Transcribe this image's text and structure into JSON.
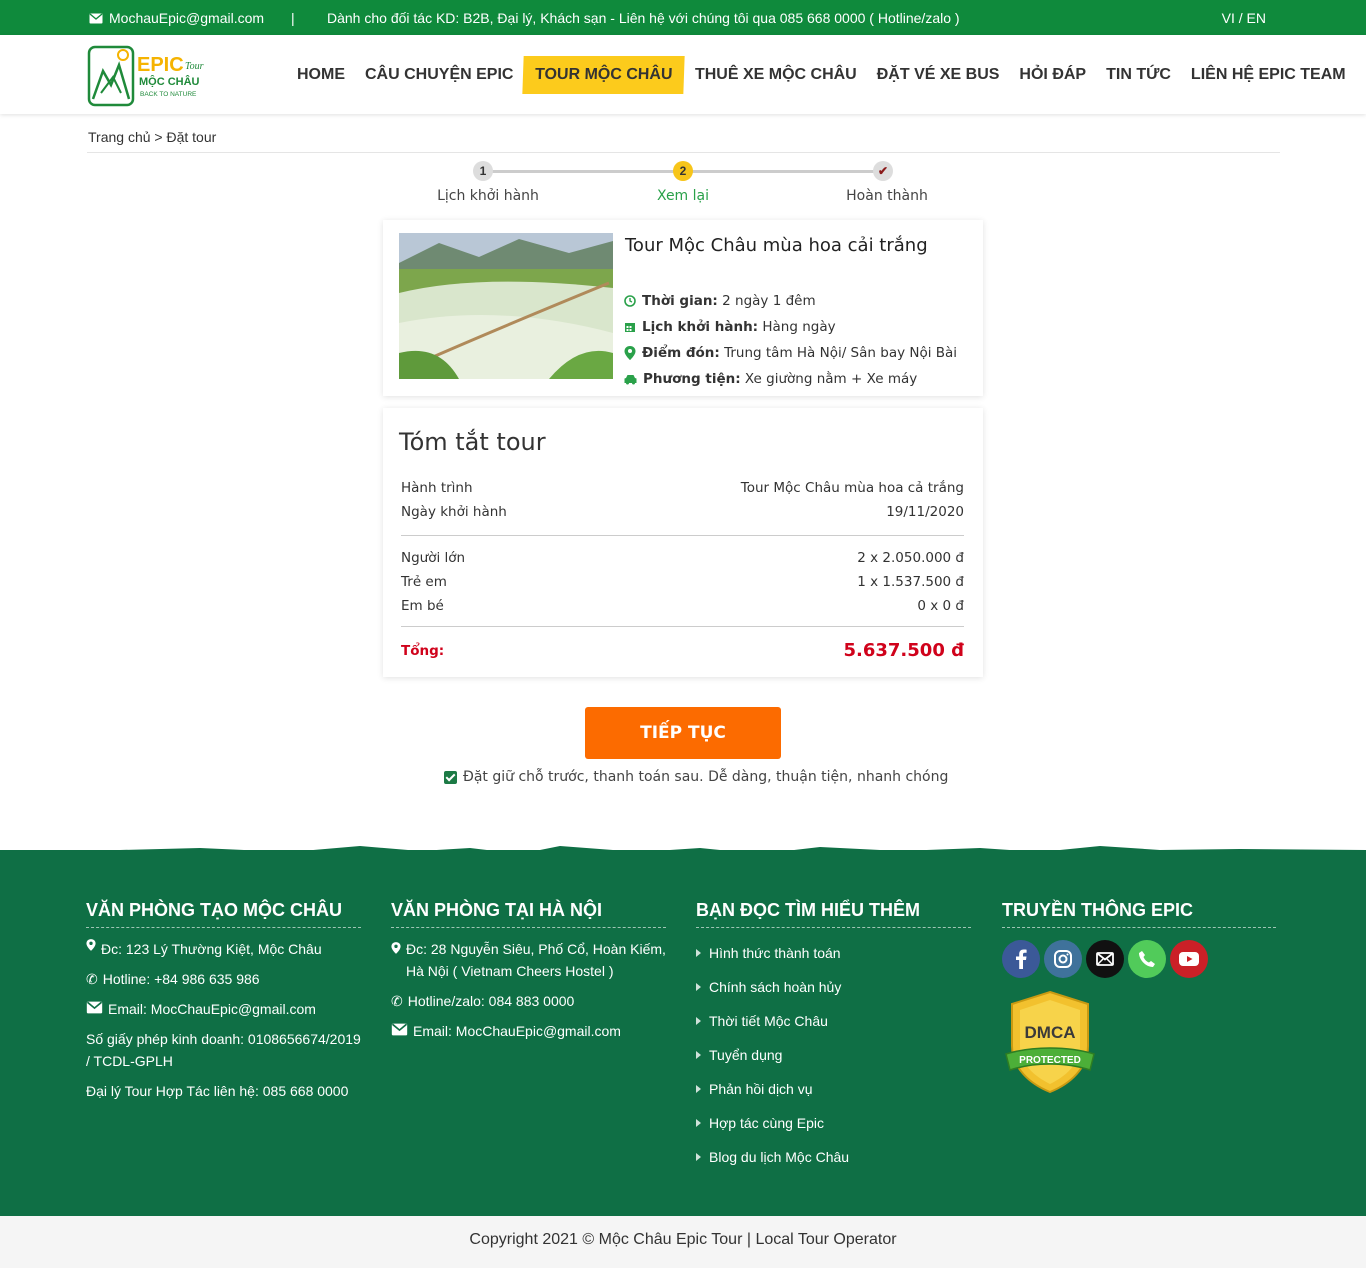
{
  "topbar": {
    "email": "MochauEpic@gmail.com",
    "separator": "|",
    "notice": "Dành cho đối tác KD: B2B, Đại lý, Khách sạn - Liên hệ với chúng tôi qua 085 668 0000 ( Hotline/zalo )",
    "lang": "VI / EN"
  },
  "logo": {
    "brand": "EPIC",
    "sub": "Tour",
    "name": "MỘC CHÂU",
    "tagline": "BACK TO NATURE"
  },
  "nav": [
    "HOME",
    "CÂU CHUYỆN EPIC",
    "TOUR MỘC CHÂU",
    "THUÊ XE MỘC CHÂU",
    "ĐẶT VÉ XE BUS",
    "HỎI ĐÁP",
    "TIN TỨC",
    "LIÊN HỆ EPIC TEAM"
  ],
  "breadcrumb": "Trang chủ > Đặt tour",
  "steps": [
    {
      "num": "1",
      "label": "Lịch khởi hành"
    },
    {
      "num": "2",
      "label": "Xem lại"
    },
    {
      "num": "✔",
      "label": "Hoàn thành"
    }
  ],
  "tour": {
    "title": "Tour Mộc Châu mùa hoa cải trắng",
    "info": [
      {
        "icon": "clock-icon",
        "label": "Thời gian:",
        "value": " 2 ngày 1 đêm"
      },
      {
        "icon": "calendar-icon",
        "label": "Lịch khởi hành:",
        "value": " Hàng ngày"
      },
      {
        "icon": "map-pin-icon",
        "label": "Điểm đón:",
        "value": " Trung tâm Hà Nội/ Sân bay Nội Bài"
      },
      {
        "icon": "car-icon",
        "label": "Phương tiện:",
        "value": " Xe giường nằm + Xe máy"
      }
    ]
  },
  "summary": {
    "title": "Tóm tắt tour",
    "route_label": "Hành trình",
    "route_value": "Tour Mộc Châu mùa hoa cả trắng",
    "date_label": "Ngày khởi hành",
    "date_value": "19/11/2020",
    "adult_label": "Người lớn",
    "adult_value": "2 x 2.050.000 đ",
    "child_label": "Trẻ em",
    "child_value": "1 x 1.537.500 đ",
    "baby_label": "Em bé",
    "baby_value": "0 x 0 đ",
    "total_label": "Tổng:",
    "total_value": "5.637.500 đ"
  },
  "continue_label": "TIẾP TỤC",
  "note": "Đặt giữ chỗ trước, thanh toán sau. Dễ dàng, thuận tiện, nhanh chóng",
  "footer": {
    "col1": {
      "title": "VĂN PHÒNG TẠO MỘC CHÂU",
      "address": "Đc: 123 Lý Thường Kiệt, Mộc Châu",
      "hotline": "Hotline: +84 986 635 986",
      "email": "Email: MocChauEpic@gmail.com",
      "license": "Số giấy phép kinh doanh: 0108656674/2019 / TCDL-GPLH",
      "agent": "Đại lý Tour Hợp Tác liên hệ: 085 668 0000"
    },
    "col2": {
      "title": "VĂN PHÒNG TẠI HÀ NỘI",
      "address": "Đc: 28 Nguyễn Siêu, Phố Cổ, Hoàn Kiếm, Hà Nội ( Vietnam Cheers Hostel )",
      "hotline": "Hotline/zalo: 084 883 0000",
      "email": "Email: MocChauEpic@gmail.com"
    },
    "col3": {
      "title": "BẠN ĐỌC TÌM HIỂU THÊM",
      "links": [
        "Hình thức thành toán",
        "Chính sách hoàn hủy",
        "Thời tiết Mộc Châu",
        "Tuyển dụng",
        "Phản hồi dịch vụ",
        "Hợp tác cùng Epic",
        "Blog du lịch Mộc Châu"
      ]
    },
    "col4": {
      "title": "TRUYỀN THÔNG EPIC",
      "dmca": "DMCA",
      "dmca_sub": "PROTECTED"
    }
  },
  "copyright": "Copyright 2021 © Mộc Châu Epic Tour | Local Tour Operator",
  "colors": {
    "primary_green": "#0f8a3c",
    "footer_green": "#0f6f45",
    "accent_yellow": "#fccb1c",
    "button_orange": "#fc6b00",
    "total_red": "#d0021b"
  }
}
